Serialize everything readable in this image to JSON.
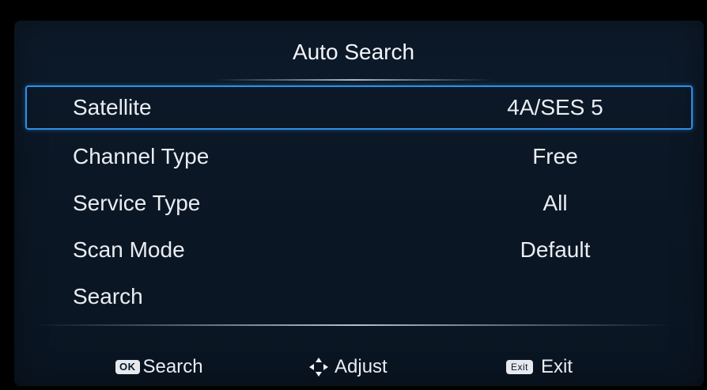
{
  "header": {
    "title": "Auto Search"
  },
  "menu": {
    "items": [
      {
        "label": "Satellite",
        "value": "4A/SES 5",
        "selected": true
      },
      {
        "label": "Channel Type",
        "value": "Free",
        "selected": false
      },
      {
        "label": "Service Type",
        "value": "All",
        "selected": false
      },
      {
        "label": "Scan Mode",
        "value": "Default",
        "selected": false
      },
      {
        "label": "Search",
        "value": "",
        "selected": false
      }
    ]
  },
  "footer": {
    "ok": {
      "key": "OK",
      "label": "Search"
    },
    "adjust": {
      "icon": "dpad-icon",
      "label": "Adjust"
    },
    "exit": {
      "key": "Exit",
      "label": "Exit"
    }
  },
  "colors": {
    "background": "#0b1725",
    "selection_border": "#2f8fe6",
    "text": "#e9edf2"
  }
}
